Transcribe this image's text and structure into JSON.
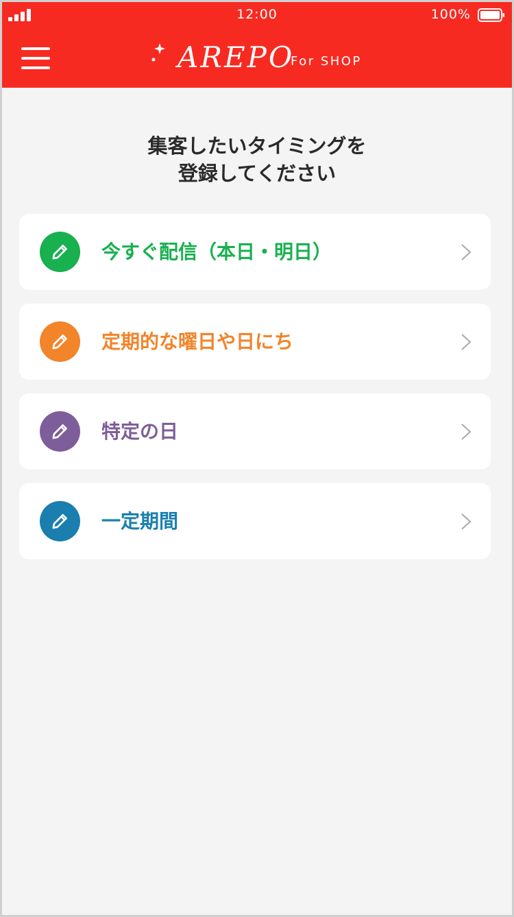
{
  "status_bar": {
    "time": "12:00",
    "battery": "100%"
  },
  "header": {
    "logo_main": "AREPO",
    "logo_sub": "For SHOP",
    "menu_icon": "hamburger-menu-icon"
  },
  "page": {
    "title_line1": "集客したいタイミングを",
    "title_line2": "登録してください"
  },
  "options": [
    {
      "label": "今すぐ配信（本日・明日）",
      "color": "#19b04f",
      "icon": "pencil-icon"
    },
    {
      "label": "定期的な曜日や日にち",
      "color": "#f2842a",
      "icon": "pencil-icon"
    },
    {
      "label": "特定の日",
      "color": "#7e5e9a",
      "icon": "pencil-icon"
    },
    {
      "label": "一定期間",
      "color": "#1a7fae",
      "icon": "pencil-icon"
    }
  ],
  "colors": {
    "header_bg": "#f72a22",
    "page_bg": "#f4f4f4",
    "card_bg": "#ffffff",
    "title_text": "#2a2a2a",
    "chevron": "#a9a9a9"
  }
}
